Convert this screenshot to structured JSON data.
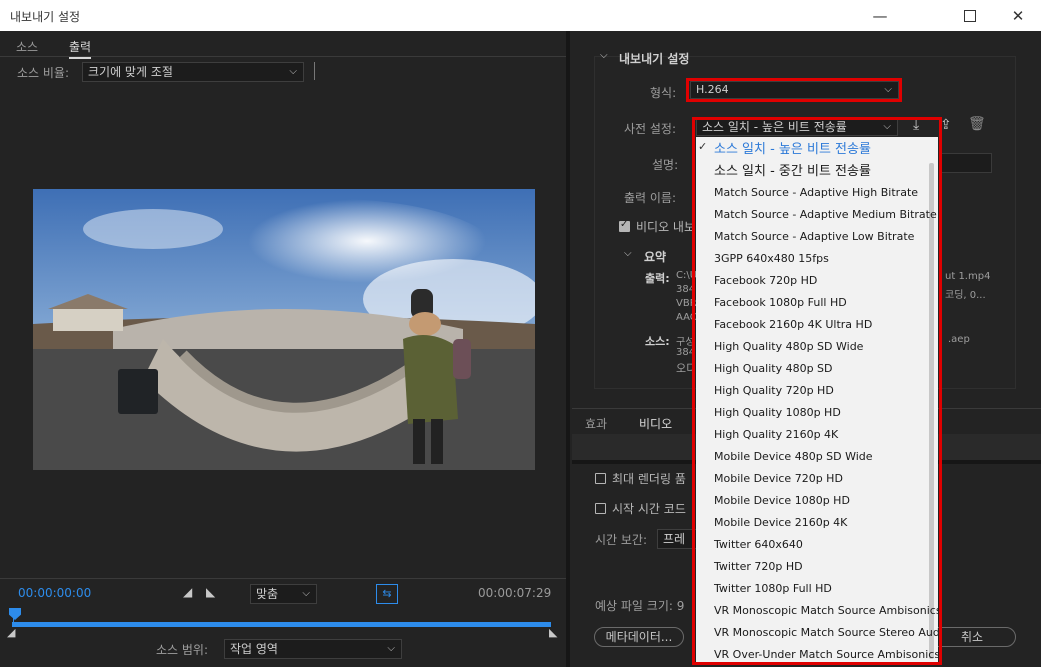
{
  "window": {
    "title": "내보내기 설정"
  },
  "left": {
    "tabs": [
      "소스",
      "출력"
    ],
    "scale_label": "소스 비율:",
    "scale_value": "크기에 맞게 조절",
    "timecode_start": "00:00:00:00",
    "timecode_end": "00:00:07:29",
    "fit_value": "맞춤",
    "range_label": "소스 범위:",
    "range_value": "작업 영역"
  },
  "right": {
    "section_title": "내보내기 설정",
    "format_label": "형식:",
    "format_value": "H.264",
    "preset_label": "사전 설정:",
    "preset_value": "소스 일치 - 높은 비트 전송률",
    "comment_label": "설명:",
    "output_label": "출력 이름:",
    "export_video_label": "비디오 내보",
    "summary_title": "요약",
    "summary_output_label": "출력:",
    "summary_output_lines": [
      "C:\\U",
      "384",
      "VBR",
      "AAC"
    ],
    "summary_output_tail": [
      "ut 1.mp4",
      "코딩, 0..."
    ],
    "summary_source_label": "소스:",
    "summary_source_lines": [
      "구성",
      "384",
      "오디"
    ],
    "summary_source_tail": ".aep",
    "tabs": [
      "효과",
      "비디오"
    ],
    "max_render_label": "최대 렌더링 품",
    "start_tc_label": "시작 시간 코드",
    "time_interp_label": "시간 보간:",
    "time_interp_value": "프레임",
    "est_size_label": "예상 파일 크기: 9",
    "metadata_button": "메타데이터...",
    "cancel_button": "취소"
  },
  "preset_options": [
    "소스 일치 - 높은 비트 전송률",
    "소스 일치 - 중간 비트 전송률",
    "Match Source - Adaptive High Bitrate",
    "Match Source - Adaptive Medium Bitrate",
    "Match Source - Adaptive Low Bitrate",
    "3GPP 640x480 15fps",
    "Facebook 720p HD",
    "Facebook 1080p Full HD",
    "Facebook 2160p 4K Ultra HD",
    "High Quality 480p SD Wide",
    "High Quality 480p SD",
    "High Quality 720p HD",
    "High Quality 1080p HD",
    "High Quality 2160p 4K",
    "Mobile Device 480p SD Wide",
    "Mobile Device 720p HD",
    "Mobile Device 1080p HD",
    "Mobile Device 2160p 4K",
    "Twitter 640x640",
    "Twitter 720p HD",
    "Twitter 1080p Full HD",
    "VR Monoscopic Match Source Ambisonics",
    "VR Monoscopic Match Source Stereo Audio",
    "VR Over-Under Match Source Ambisonics"
  ],
  "colors": {
    "highlight_red": "#e00000",
    "accent_blue": "#2d8ceb",
    "selected_item": "#2d7ad8"
  },
  "playhead_position": 0
}
